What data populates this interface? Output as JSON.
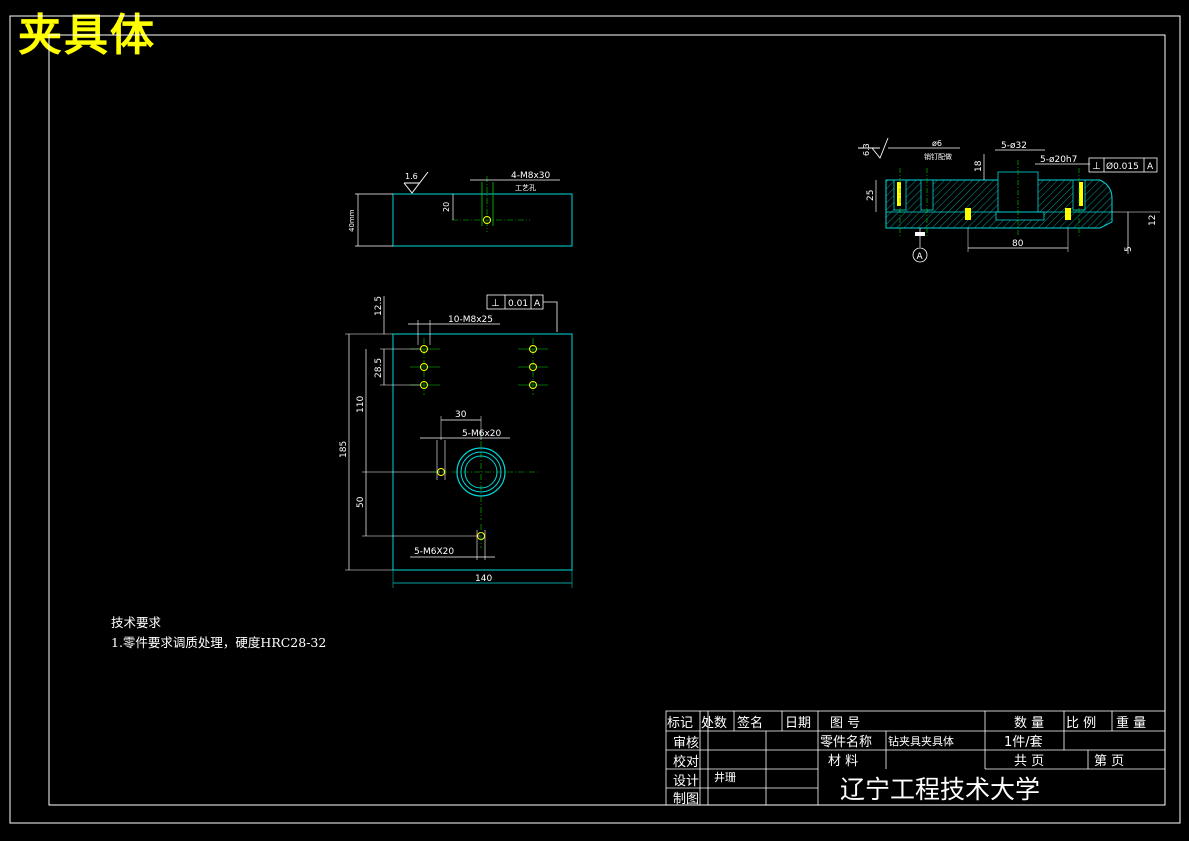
{
  "drawing": {
    "title": "夹具体",
    "colors": {
      "background": "#000000",
      "frame": "#ffffff",
      "part_outline": "#00d7d7",
      "center_line": "#00d000",
      "dimension": "#ffffff",
      "title_text": "#ffff00",
      "hatch": "#00b8b8",
      "hole": "#ffff00"
    }
  },
  "top_view": {
    "roughness": "1.6",
    "hole_note": "4-M8x30",
    "hole_sub_note": "工艺孔",
    "dim_hole_offset": "20",
    "dim_thickness": "40mm"
  },
  "front_view": {
    "tolerance": {
      "symbol": "⊥",
      "value": "0.01",
      "datum": "A"
    },
    "thread_note_1": "10-M8x25",
    "dim_top_offset": "12.5",
    "dim_hole_spacing": "28.5",
    "dim_height_110": "110",
    "dim_height_185": "185",
    "dim_height_50": "50",
    "dim_30": "30",
    "thread_note_2": "5-M6x20",
    "thread_note_3": "5-M6X20",
    "dim_width": "140"
  },
  "section_view": {
    "roughness": "6.3",
    "hole_note_1": "ø6",
    "hole_note_1_sub": "销钉配做",
    "hole_note_2": "5-ø32",
    "hole_note_3": "5-ø20h7",
    "tolerance": {
      "symbol": "⊥",
      "value": "Ø0.015",
      "datum": "A"
    },
    "dim_18": "18",
    "dim_25": "25",
    "dim_80": "80",
    "dim_12": "12",
    "dim_5": "5",
    "datum_label": "A"
  },
  "tech_requirements": {
    "heading": "技术要求",
    "items": [
      "1.零件要求调质处理，硬度HRC28-32"
    ]
  },
  "title_block": {
    "header_cells": [
      "标记",
      "处数",
      "签名",
      "日期",
      "图 号"
    ],
    "qty_header": "数 量",
    "scale_header": "比 例",
    "weight_header": "重 量",
    "row_labels": [
      "审核",
      "校对",
      "设计",
      "制图"
    ],
    "designer": "井珊",
    "part_name_label": "零件名称",
    "part_name": "钻夹具夹具体",
    "quantity": "1件/套",
    "material_label": "材 料",
    "total_pages": "共 页",
    "page_label": "第 页",
    "institution": "辽宁工程技术大学"
  }
}
